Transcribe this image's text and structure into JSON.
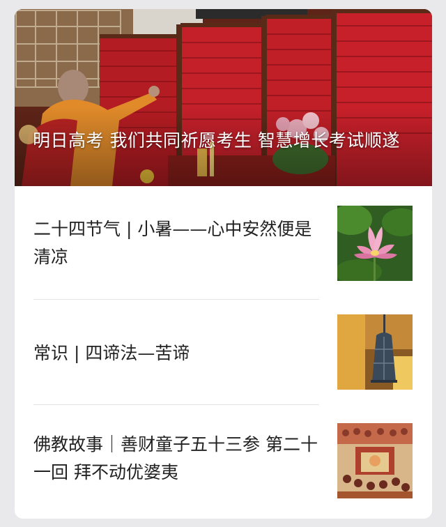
{
  "hero": {
    "title": "明日高考 我们共同祈愿考生 智慧增长考试顺遂"
  },
  "articles": [
    {
      "title": "二十四节气 | 小暑——心中安然便是清凉",
      "thumb_icon": "lotus-thumbnail"
    },
    {
      "title": "常识 | 四谛法—苦谛",
      "thumb_icon": "bell-thumbnail"
    },
    {
      "title": "佛教故事｜善财童子五十三参 第二十一回 拜不动优婆夷",
      "thumb_icon": "painting-thumbnail"
    }
  ],
  "colors": {
    "background": "#e9e9ec",
    "card": "#ffffff",
    "text": "#222222",
    "banner_red": "#c8202a"
  }
}
